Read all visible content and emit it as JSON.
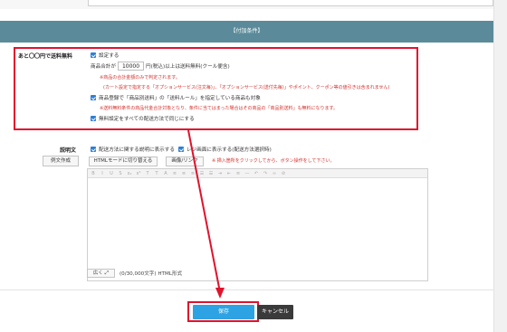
{
  "section": {
    "title": "【付加条件】"
  },
  "free_shipping": {
    "label": "あと〇〇円で送料無料",
    "setting_label": "設定する",
    "total_prefix": "商品合計が",
    "amount": "10000",
    "total_suffix": "円(税込)以上は送料無料(クール便含)",
    "note1": "※商品の合計金額のみで判定されます。",
    "note2": "(カート設定で指定する「オプションサービス(注文毎)」、「オプションサービス(送付先毎)」やポイント、クーポン等の値引きは含まれません)",
    "product_rule_label": "商品登録で「商品別送料」の「送料ルール」を指定している商品も対象",
    "note3": "※送料無料条件の商品代金合計対象となり、条件に当てはまった場合はその商品の「商品別送料」も無料になります。",
    "same_setting_label": "無料設定をすべての配送方法で同じにする"
  },
  "description": {
    "label": "説明文",
    "example_button": "例文作成",
    "show_desc_label": "配送方法に関する説明に表示する",
    "show_register_label": "レジ画面に表示する(配送方法選択時)",
    "html_mode_button": "HTMLモードに切り替える",
    "image_link_button": "画像/リンク",
    "insert_note": "※ 挿入箇所をクリックしてから、ボタン操作をして下さい。",
    "widen_button": "広く",
    "char_count": "(0/30,000文字) HTML形式"
  },
  "toolbar_icons": [
    "bold-icon",
    "italic-icon",
    "underline-icon",
    "strike-icon",
    "subscript-icon",
    "superscript-icon",
    "text-color-icon",
    "bg-color-icon",
    "font-size-icon",
    "align-left-icon",
    "align-center-icon",
    "align-right-icon",
    "list-ul-icon",
    "list-ol-icon",
    "indent-icon",
    "outdent-icon",
    "justify-icon",
    "hr-icon",
    "undo-icon",
    "redo-icon",
    "link-icon",
    "unlink-icon"
  ],
  "actions": {
    "save": "保存",
    "cancel": "キャンセル"
  },
  "colors": {
    "header": "#5b8b9a",
    "highlight": "#e0132d",
    "save": "#2ea3e3",
    "cancel": "#3a3a3a",
    "checkbox": "#2f7fd6",
    "note": "#d2322d"
  }
}
